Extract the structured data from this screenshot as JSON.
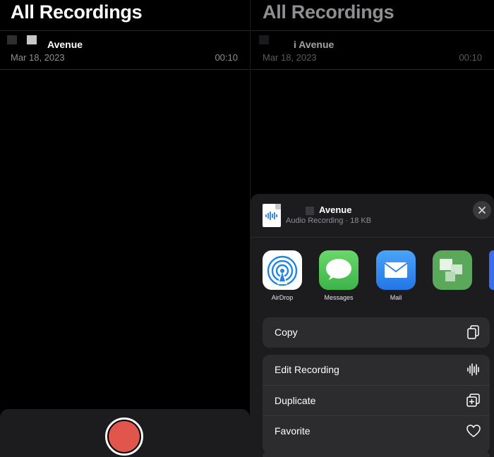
{
  "left_screen": {
    "title": "All Recordings",
    "recording": {
      "name": "Avenue",
      "date": "Mar 18, 2023",
      "duration": "00:10"
    }
  },
  "right_screen": {
    "title": "All Recordings",
    "recording": {
      "name": "i Avenue",
      "date": "Mar 18, 2023",
      "duration": "00:10"
    },
    "share_sheet": {
      "file_name": "Avenue",
      "file_info": "Audio Recording · 18 KB",
      "close_icon": "close-icon",
      "apps": [
        {
          "label": "AirDrop",
          "icon": "airdrop-icon",
          "color": "#ffffff"
        },
        {
          "label": "Messages",
          "icon": "messages-icon",
          "color": "#5ac85a"
        },
        {
          "label": "Mail",
          "icon": "mail-icon",
          "color": "#3c8cf0"
        },
        {
          "label": "",
          "icon": "app-icon",
          "color": "#5aa85a"
        }
      ],
      "actions": [
        {
          "label": "Copy",
          "icon": "copy-icon"
        },
        {
          "label": "Edit Recording",
          "icon": "waveform-icon"
        },
        {
          "label": "Duplicate",
          "icon": "duplicate-icon"
        },
        {
          "label": "Favorite",
          "icon": "heart-icon"
        }
      ]
    }
  },
  "colors": {
    "record": "#e0554c",
    "background": "#000000",
    "sheet": "#1c1c1e",
    "row": "#2c2c2e"
  }
}
